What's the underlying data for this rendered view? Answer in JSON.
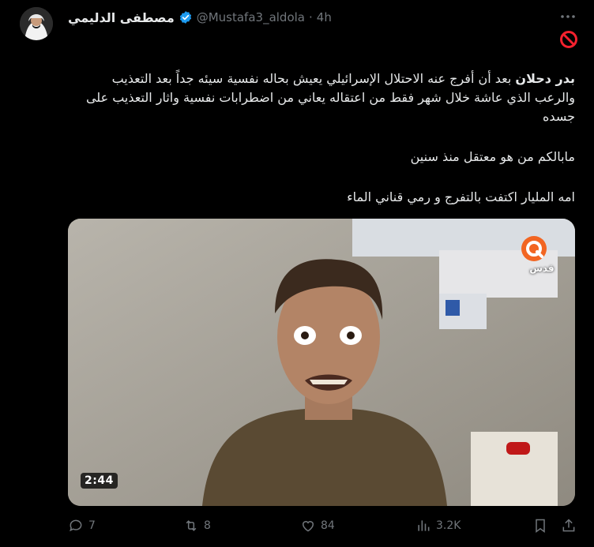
{
  "author": {
    "display_name": "مصطفى الدليمي",
    "handle": "@Mustafa3_aldola",
    "separator": "·",
    "time": "4h",
    "verified_icon": "verified-badge-icon"
  },
  "tweet": {
    "para1_bold": "بدر دحلان",
    "para1_rest": " بعد أن أفرج عنه الاحتلال الإسرائيلي يعيش بحاله نفسية سيئه جداً بعد التعذيب والرعب الذي عاشة خلال شهر فقط من اعتقاله يعاني من اضطرابات نفسية واثار التعذيب على جسده",
    "para2": "مابالكم من هو معتقل منذ سنين",
    "para3": "امه المليار اكتفت بالتفرج و رمي قناني الماء"
  },
  "media": {
    "duration": "2:44",
    "channel_logo_text": "قدس"
  },
  "actions": {
    "replies": "7",
    "reposts": "8",
    "likes": "84",
    "views": "3.2K"
  },
  "colors": {
    "background": "#000000",
    "text": "#e7e9ea",
    "muted": "#71767b",
    "verified": "#1d9bf0",
    "block": "#f4212e"
  }
}
